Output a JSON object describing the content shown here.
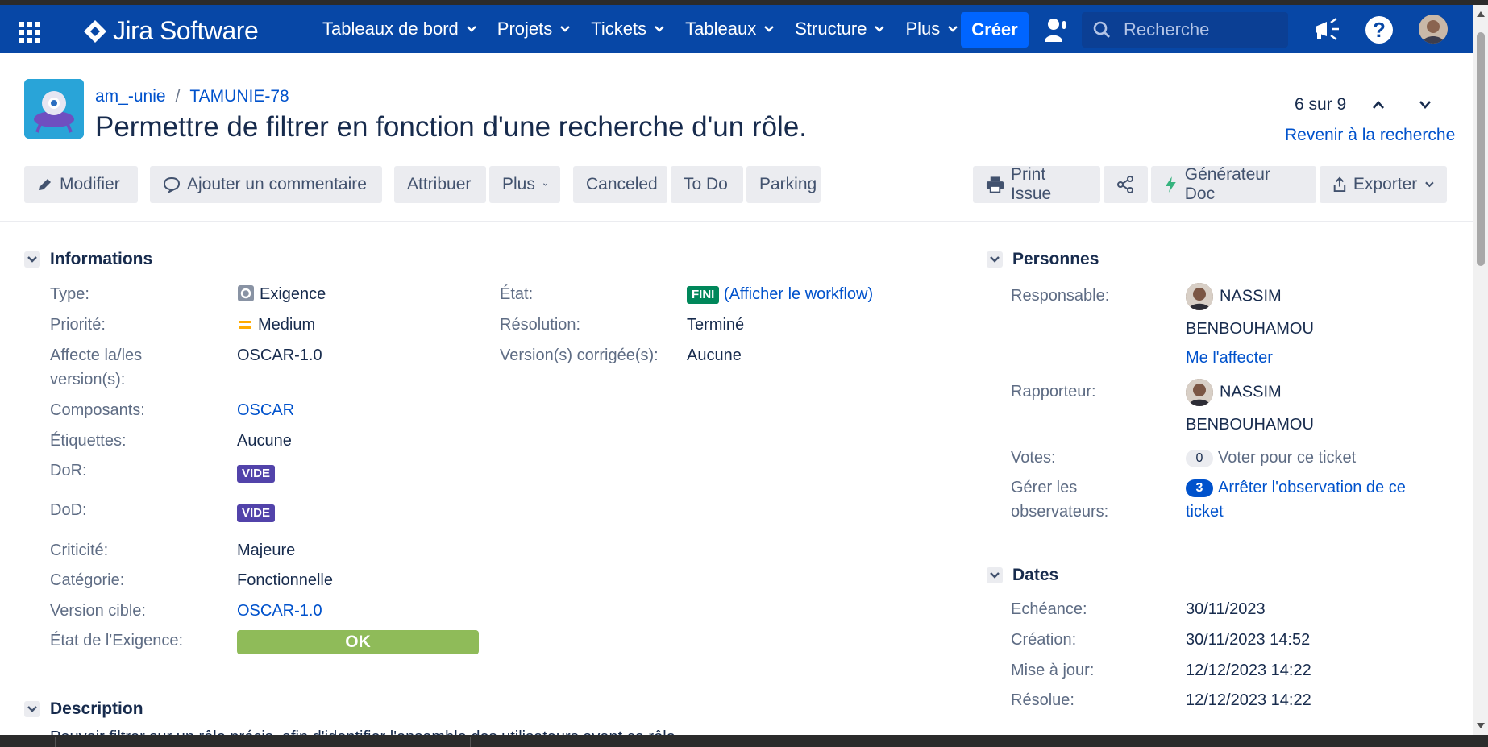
{
  "topnav": {
    "logo_text": "Jira Software",
    "menus": [
      "Tableaux de bord",
      "Projets",
      "Tickets",
      "Tableaux",
      "Structure",
      "Plus"
    ],
    "create_label": "Créer",
    "search_placeholder": "Recherche",
    "brand_color": "#0747a6",
    "create_color": "#0065ff"
  },
  "header": {
    "breadcrumb_project": "am_-unie",
    "breadcrumb_sep": "/",
    "breadcrumb_issue": "TAMUNIE-78",
    "title": "Permettre de filtrer en fonction d'une recherche d'un rôle.",
    "pager": "6 sur 9",
    "back_to_search": "Revenir à la recherche"
  },
  "toolbar": {
    "edit": "Modifier",
    "comment": "Ajouter un commentaire",
    "assign": "Attribuer",
    "more": "Plus",
    "canceled": "Canceled",
    "todo": "To Do",
    "parking": "Parking",
    "print": "Print Issue",
    "doc_gen": "Générateur Doc",
    "export": "Exporter"
  },
  "informations": {
    "heading": "Informations",
    "type_label": "Type:",
    "type_value": "Exigence",
    "priority_label": "Priorité:",
    "priority_value": "Medium",
    "affects_label_1": "Affecte la/les",
    "affects_label_2": "version(s):",
    "affects_value": "OSCAR-1.0",
    "components_label": "Composants:",
    "components_value": "OSCAR",
    "labels_label": "Étiquettes:",
    "labels_value": "Aucune",
    "dor_label": "DoR:",
    "dor_value": "VIDE",
    "dod_label": "DoD:",
    "dod_value": "VIDE",
    "criticity_label": "Criticité:",
    "criticity_value": "Majeure",
    "category_label": "Catégorie:",
    "category_value": "Fonctionnelle",
    "target_version_label": "Version cible:",
    "target_version_value": "OSCAR-1.0",
    "req_state_label": "État de l'Exigence:",
    "req_state_value": "OK",
    "status_label": "État:",
    "status_value": "FINI",
    "workflow_link": "(Afficher le workflow)",
    "resolution_label": "Résolution:",
    "resolution_value": "Terminé",
    "fix_versions_label": "Version(s) corrigée(s):",
    "fix_versions_value": "Aucune"
  },
  "people": {
    "heading": "Personnes",
    "assignee_label": "Responsable:",
    "assignee_first": "NASSIM",
    "assignee_last": "BENBOUHAMOU",
    "assign_me": "Me l'affecter",
    "reporter_label": "Rapporteur:",
    "reporter_first": "NASSIM",
    "reporter_last": "BENBOUHAMOU",
    "votes_label": "Votes:",
    "votes_count": "0",
    "vote_link": "Voter pour ce ticket",
    "watchers_label_1": "Gérer les",
    "watchers_label_2": "observateurs:",
    "watchers_count": "3",
    "watch_link_1": "Arrêter l'observation de ce",
    "watch_link_2": "ticket"
  },
  "dates": {
    "heading": "Dates",
    "due_label": "Echéance:",
    "due_value": "30/11/2023",
    "created_label": "Création:",
    "created_value": "30/11/2023 14:52",
    "updated_label": "Mise à jour:",
    "updated_value": "12/12/2023 14:22",
    "resolved_label": "Résolue:",
    "resolved_value": "12/12/2023 14:22"
  },
  "description": {
    "heading": "Description",
    "text": "Pouvoir filtrer sur un rôle précis, afin d'identifier l'ensemble des utilisateurs ayant ce rôle."
  },
  "colors": {
    "status_done": "#00875a",
    "lozenge_purple": "#5243aa",
    "ok_green": "#8fbb59",
    "link": "#0052cc"
  }
}
